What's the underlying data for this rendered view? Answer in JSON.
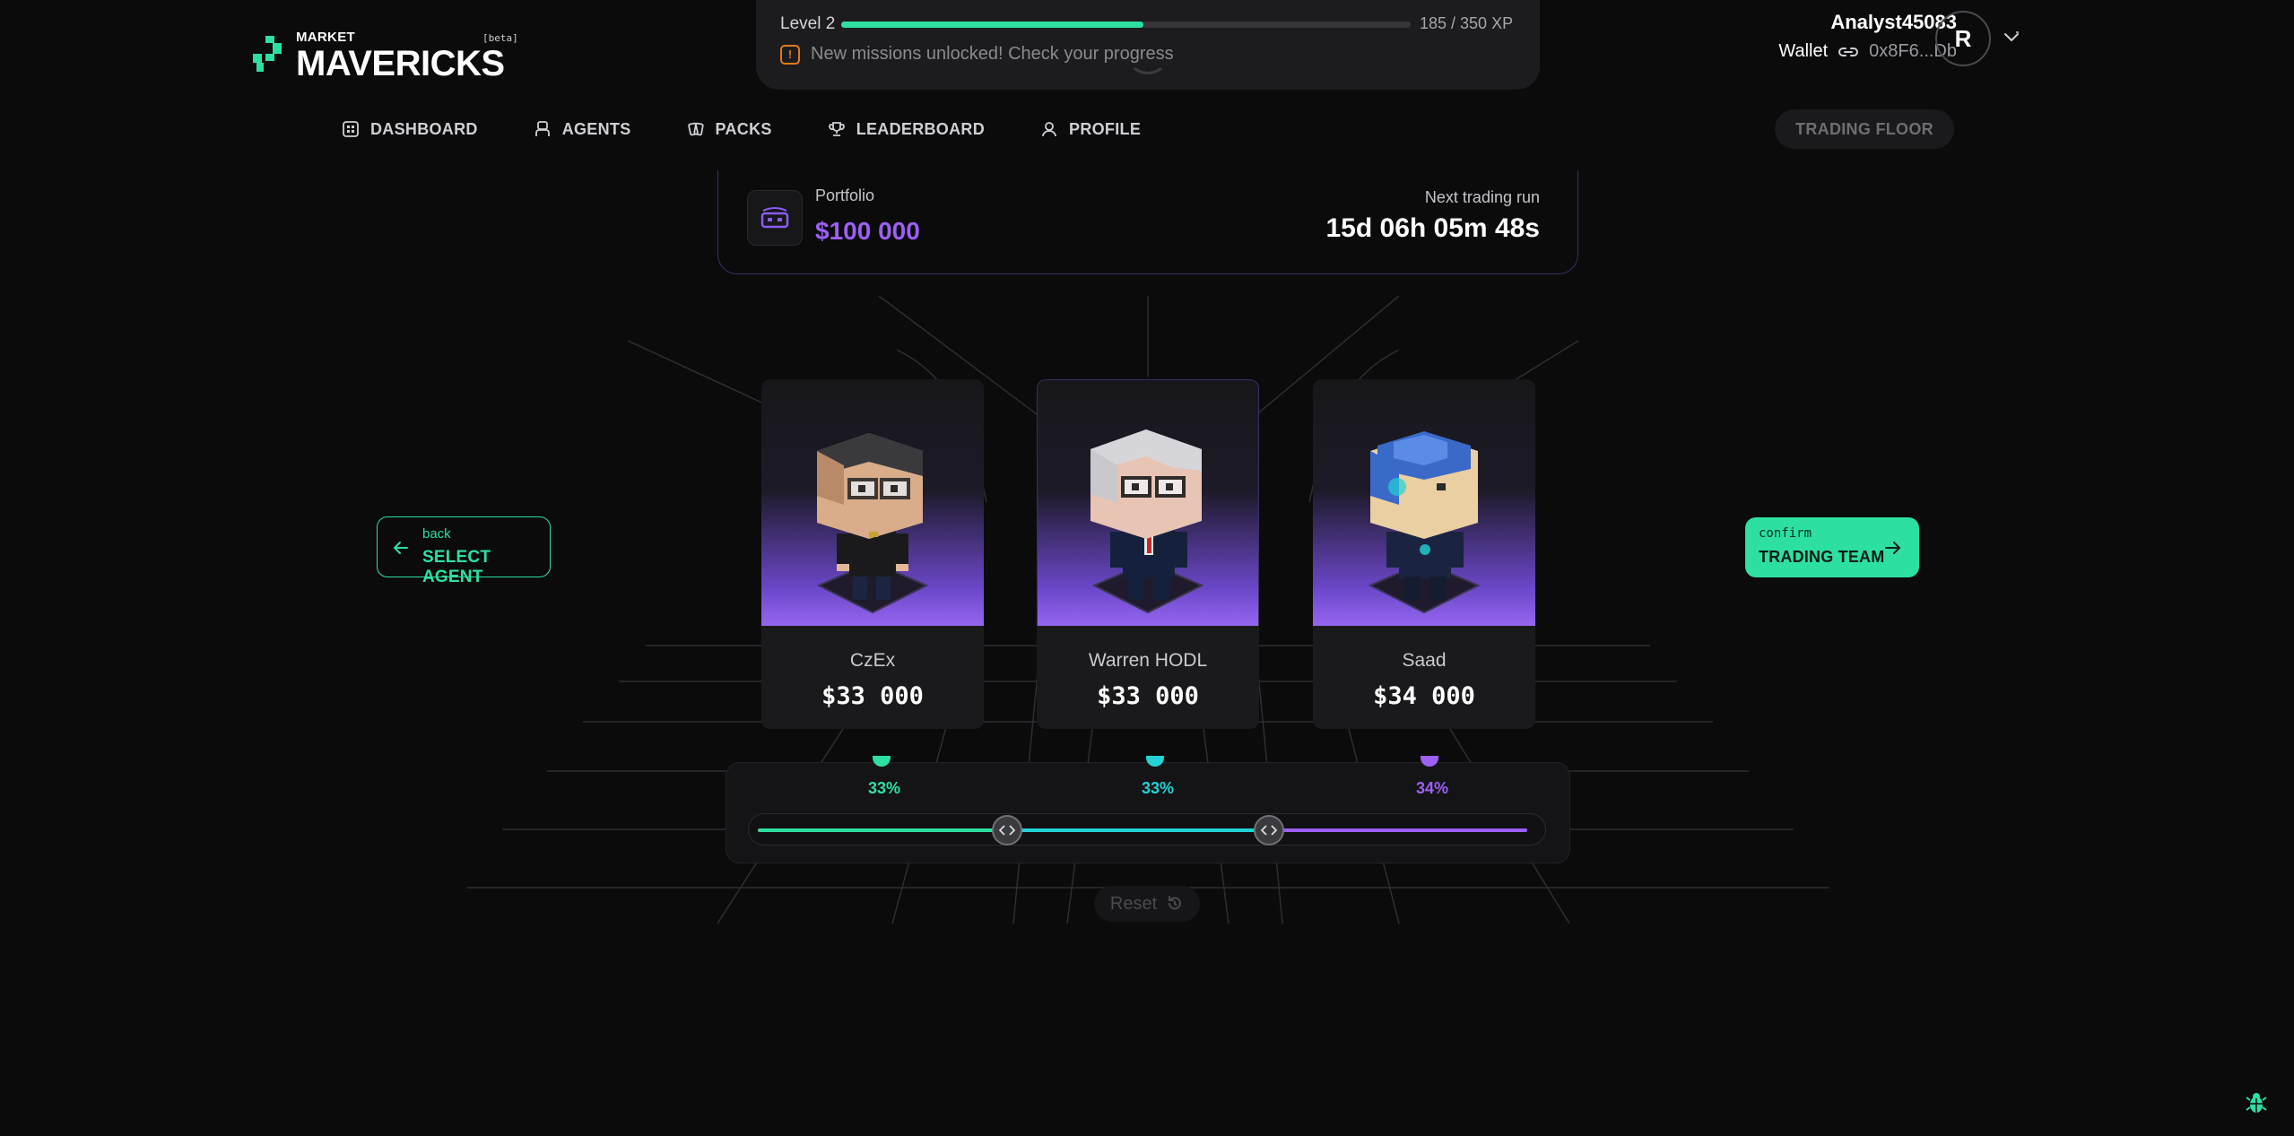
{
  "logo": {
    "small": "MARKET",
    "big": "MAVERICKS",
    "beta": "[beta]"
  },
  "xp": {
    "level": "Level 2",
    "value_text": "185 / 350 XP",
    "progress_fraction": 0.53,
    "notice": "New missions unlocked! Check your progress",
    "notice_icon": "!"
  },
  "user": {
    "name": "Analyst45083",
    "wallet_label": "Wallet",
    "wallet_address": "0x8F6...Db",
    "avatar_initial": "R"
  },
  "nav": {
    "items": [
      {
        "label": "DASHBOARD",
        "icon": "dashboard-icon"
      },
      {
        "label": "AGENTS",
        "icon": "agent-icon"
      },
      {
        "label": "PACKS",
        "icon": "packs-icon"
      },
      {
        "label": "LEADERBOARD",
        "icon": "trophy-icon"
      },
      {
        "label": "PROFILE",
        "icon": "user-icon"
      }
    ],
    "trading_floor": "TRADING FLOOR"
  },
  "portfolio": {
    "label": "Portfolio",
    "value": "$100 000",
    "run_label": "Next trading run",
    "run_countdown": "15d 06h 05m 48s"
  },
  "back": {
    "small": "back",
    "big": "SELECT AGENT"
  },
  "confirm": {
    "small": "confirm",
    "big": "TRADING TEAM"
  },
  "agents": [
    {
      "name": "CzEx",
      "amount": "$33 000",
      "percent": "33%",
      "color": "#2de0a0"
    },
    {
      "name": "Warren HODL",
      "amount": "$33 000",
      "percent": "33%",
      "color": "#22d3d6"
    },
    {
      "name": "Saad",
      "amount": "$34 000",
      "percent": "34%",
      "color": "#9d5ff5"
    }
  ],
  "reset_label": "Reset",
  "colors": {
    "accent": "#2de0a0",
    "purple": "#9d5ff5",
    "cyan": "#22d3d6",
    "warning": "#e07a1d"
  }
}
